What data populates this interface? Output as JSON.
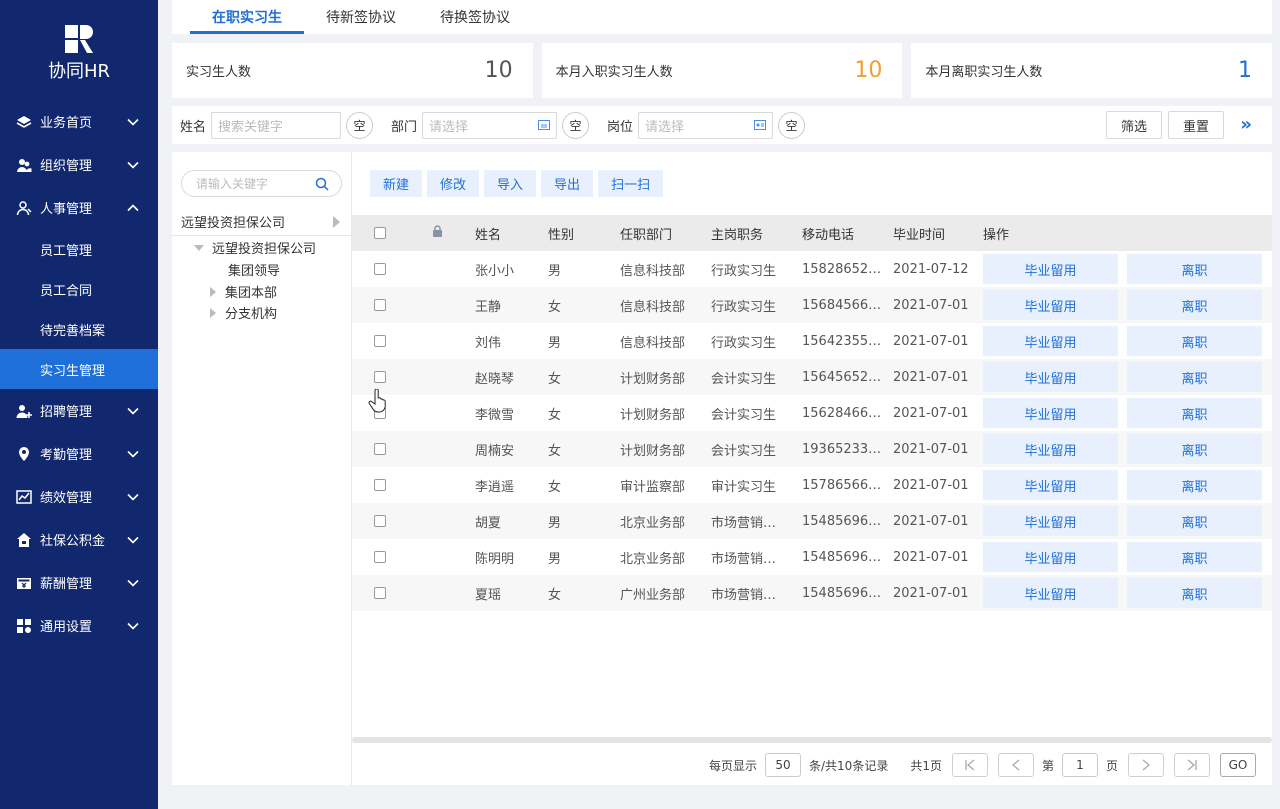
{
  "app": {
    "logo_text": "协同HR"
  },
  "sidebar": {
    "items": [
      {
        "label": "业务首页",
        "icon": "layers-icon",
        "expanded": false
      },
      {
        "label": "组织管理",
        "icon": "org-icon",
        "expanded": false
      },
      {
        "label": "人事管理",
        "icon": "person-icon",
        "expanded": true,
        "children": [
          {
            "label": "员工管理",
            "active": false
          },
          {
            "label": "员工合同",
            "active": false
          },
          {
            "label": "待完善档案",
            "active": false
          },
          {
            "label": "实习生管理",
            "active": true
          }
        ]
      },
      {
        "label": "招聘管理",
        "icon": "person-add-icon",
        "expanded": false
      },
      {
        "label": "考勤管理",
        "icon": "location-icon",
        "expanded": false
      },
      {
        "label": "绩效管理",
        "icon": "chart-icon",
        "expanded": false
      },
      {
        "label": "社保公积金",
        "icon": "house-icon",
        "expanded": false
      },
      {
        "label": "薪酬管理",
        "icon": "money-icon",
        "expanded": false
      },
      {
        "label": "通用设置",
        "icon": "grid-icon",
        "expanded": false
      }
    ]
  },
  "tabs": [
    {
      "label": "在职实习生",
      "active": true
    },
    {
      "label": "待新签协议",
      "active": false
    },
    {
      "label": "待换签协议",
      "active": false
    }
  ],
  "stats": [
    {
      "label": "实习生人数",
      "value": "10",
      "color": "#555555"
    },
    {
      "label": "本月入职实习生人数",
      "value": "10",
      "color": "#f0a030"
    },
    {
      "label": "本月离职实习生人数",
      "value": "1",
      "color": "#1f6fd9"
    }
  ],
  "filters": {
    "name_label": "姓名",
    "name_placeholder": "搜索关键字",
    "dept_label": "部门",
    "dept_placeholder": "请选择",
    "pos_label": "岗位",
    "pos_placeholder": "请选择",
    "clear_label": "空",
    "filter_btn": "筛选",
    "reset_btn": "重置",
    "expand": "»"
  },
  "tree": {
    "search_placeholder": "请输入关键字",
    "root": "远望投资担保公司",
    "node_company": "远望投资担保公司",
    "node_leaders": "集团领导",
    "node_hq": "集团本部",
    "node_branch": "分支机构"
  },
  "toolbar": {
    "new": "新建",
    "edit": "修改",
    "import": "导入",
    "export": "导出",
    "scan": "扫一扫"
  },
  "table": {
    "headers": {
      "name": "姓名",
      "sex": "性别",
      "dept": "任职部门",
      "position": "主岗职务",
      "phone": "移动电话",
      "grad": "毕业时间",
      "op": "操作"
    },
    "actions": {
      "retain": "毕业留用",
      "leave": "离职"
    },
    "rows": [
      {
        "name": "张小小",
        "sex": "男",
        "dept": "信息科技部",
        "position": "行政实习生",
        "phone": "15828652…",
        "grad": "2021-07-12"
      },
      {
        "name": "王静",
        "sex": "女",
        "dept": "信息科技部",
        "position": "行政实习生",
        "phone": "15684566…",
        "grad": "2021-07-01"
      },
      {
        "name": "刘伟",
        "sex": "男",
        "dept": "信息科技部",
        "position": "行政实习生",
        "phone": "15642355…",
        "grad": "2021-07-01"
      },
      {
        "name": "赵晓琴",
        "sex": "女",
        "dept": "计划财务部",
        "position": "会计实习生",
        "phone": "15645652…",
        "grad": "2021-07-01"
      },
      {
        "name": "李微雪",
        "sex": "女",
        "dept": "计划财务部",
        "position": "会计实习生",
        "phone": "15628466…",
        "grad": "2021-07-01"
      },
      {
        "name": "周楠安",
        "sex": "女",
        "dept": "计划财务部",
        "position": "会计实习生",
        "phone": "19365233…",
        "grad": "2021-07-01"
      },
      {
        "name": "李逍遥",
        "sex": "女",
        "dept": "审计监察部",
        "position": "审计实习生",
        "phone": "15786566…",
        "grad": "2021-07-01"
      },
      {
        "name": "胡夏",
        "sex": "男",
        "dept": "北京业务部",
        "position": "市场营销…",
        "phone": "15485696…",
        "grad": "2021-07-01"
      },
      {
        "name": "陈明明",
        "sex": "男",
        "dept": "北京业务部",
        "position": "市场营销…",
        "phone": "15485696…",
        "grad": "2021-07-01"
      },
      {
        "name": "夏瑶",
        "sex": "女",
        "dept": "广州业务部",
        "position": "市场营销…",
        "phone": "15485696…",
        "grad": "2021-07-01"
      }
    ]
  },
  "pager": {
    "per_page_label": "每页显示",
    "per_page": "50",
    "total_label": "条/共10条记录",
    "pages_label": "共1页",
    "page_prefix": "第",
    "page": "1",
    "page_suffix": "页",
    "go": "GO"
  }
}
